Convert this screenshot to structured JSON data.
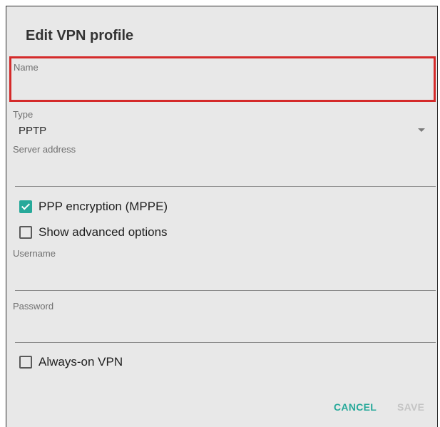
{
  "dialog": {
    "title": "Edit VPN profile"
  },
  "fields": {
    "name": {
      "label": "Name",
      "value": ""
    },
    "type": {
      "label": "Type",
      "value": "PPTP"
    },
    "server_address": {
      "label": "Server address",
      "value": ""
    },
    "username": {
      "label": "Username",
      "value": ""
    },
    "password": {
      "label": "Password",
      "value": ""
    }
  },
  "checkboxes": {
    "ppp_encryption": {
      "label": "PPP encryption (MPPE)",
      "checked": true
    },
    "show_advanced": {
      "label": "Show advanced options",
      "checked": false
    },
    "always_on": {
      "label": "Always-on VPN",
      "checked": false
    }
  },
  "actions": {
    "cancel_label": "CANCEL",
    "save_label": "SAVE"
  },
  "colors": {
    "accent": "#27a99a",
    "highlight_border": "#d42a2a",
    "disabled_text": "#c4c4c4"
  },
  "icons": {
    "dropdown": "arrow-drop-down-icon",
    "check": "check-icon"
  }
}
